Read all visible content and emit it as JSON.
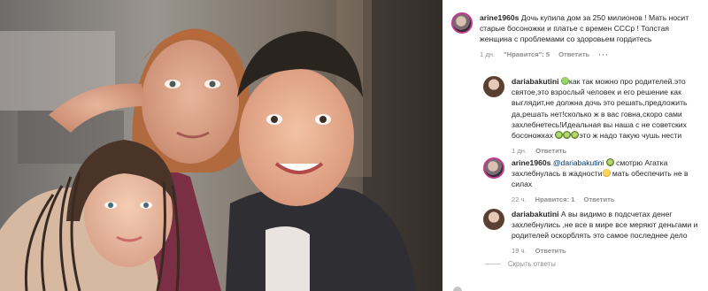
{
  "post_photo": {
    "description_icon": "family-photo"
  },
  "comments": [
    {
      "username": "arine1960s",
      "text": "Дочь купила дом за 250 милионов ! Мать носит старые босоножки и платье с времен СССр ! Толстая женщина с проблемами со здоровьем гордитесь",
      "time": "1 дн.",
      "likes": "\"Нравится\": 5",
      "reply": "Ответить",
      "more": "···"
    },
    {
      "username": "dariabakutini",
      "text_parts": [
        "как так можно про родителей.это святое,это взрослый человек и его решение как выглядит,не должна дочь это решать,предложить да,решать нет!сколько ж в вас говна,скоро сами захлебнетесь!Идеальная вы наша с не советских босоножках ",
        "это ж надо такую чушь нести"
      ],
      "time": "1 дн.",
      "reply": "Ответить"
    },
    {
      "username": "arine1960s",
      "mention": "@dariabakutini",
      "text_parts": [
        " смотрю Агатка захлебнулась в жадности",
        " мать обеспечить не в силах"
      ],
      "time": "22 ч.",
      "likes": "Нравится: 1",
      "reply": "Ответить"
    },
    {
      "username": "dariabakutini",
      "text": "А вы видимо в подсчетах денег захлебнулись ,не все в мире все меряют деньгами и родителей оскорблять это самое последнее дело",
      "time": "19 ч.",
      "reply": "Ответить"
    }
  ],
  "hide_replies": "Скрыть ответы",
  "colors": {
    "link": "#00376b",
    "meta": "#8e8e8e",
    "story_ring": "#c23a8a"
  }
}
